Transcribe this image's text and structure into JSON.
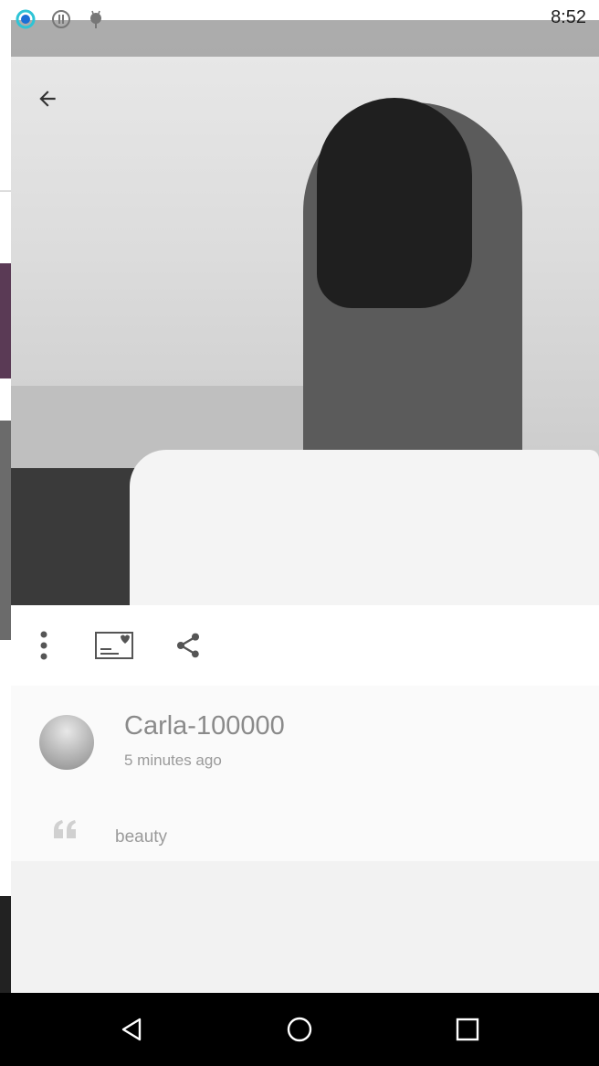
{
  "status_bar": {
    "time": "8:52",
    "icons": [
      "circle-app-icon",
      "info-notification-icon",
      "android-debug-icon"
    ]
  },
  "post": {
    "username": "Carla-100000",
    "time_ago": "5 minutes ago",
    "caption": "beauty"
  },
  "actions": {
    "icons": [
      "more-vertical-icon",
      "save-card-icon",
      "share-icon"
    ]
  },
  "colors": {
    "status_ring_accent": "#2ec4d6",
    "muted_text": "#9a9a9a",
    "nav_bar": "#000000"
  }
}
